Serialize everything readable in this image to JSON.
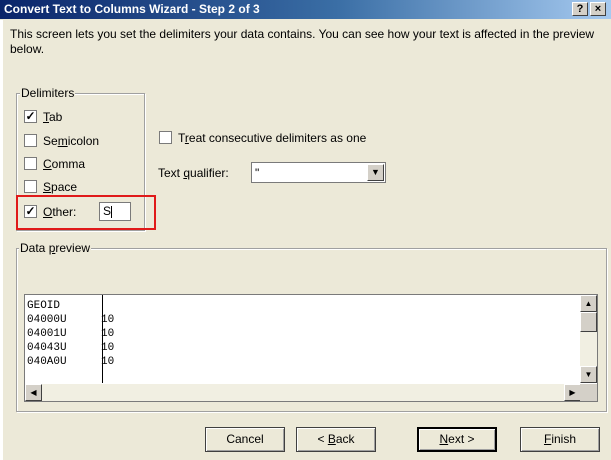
{
  "window": {
    "title": "Convert Text to Columns Wizard - Step 2 of 3",
    "help_label": "?",
    "close_label": "×"
  },
  "intro_text": "This screen lets you set the delimiters your data contains.  You can see how your text is affected in the preview below.",
  "delimiters": {
    "group_label": "Delimiters",
    "tab": {
      "label_u": "T",
      "label_rest": "ab",
      "checked": true
    },
    "semicolon": {
      "label_pre": "Se",
      "label_u": "m",
      "label_rest": "icolon",
      "checked": false
    },
    "comma": {
      "label_u": "C",
      "label_rest": "omma",
      "checked": false
    },
    "space": {
      "label_u": "S",
      "label_rest": "pace",
      "checked": false
    },
    "other": {
      "label_u": "O",
      "label_rest": "ther:",
      "checked": true,
      "value": "S"
    }
  },
  "consecutive": {
    "label_pre": "T",
    "label_u": "r",
    "label_rest": "eat consecutive delimiters as one",
    "checked": false
  },
  "text_qualifier": {
    "label_pre": "Text ",
    "label_u": "q",
    "label_rest": "ualifier:",
    "value": "\""
  },
  "preview": {
    "group_label_pre": "Data ",
    "group_label_u": "p",
    "group_label_rest": "review",
    "rows": [
      [
        "GEOID",
        ""
      ],
      [
        "04000U",
        "10"
      ],
      [
        "04001U",
        "10"
      ],
      [
        "04043U",
        "10"
      ],
      [
        "040A0U",
        "10"
      ]
    ]
  },
  "buttons": {
    "cancel": "Cancel",
    "back": {
      "pre": "< ",
      "u": "B",
      "rest": "ack"
    },
    "next": {
      "u": "N",
      "rest": "ext >"
    },
    "finish": {
      "u": "F",
      "rest": "inish"
    }
  },
  "check_glyph": "✓",
  "highlight_color": "#e01a1a"
}
